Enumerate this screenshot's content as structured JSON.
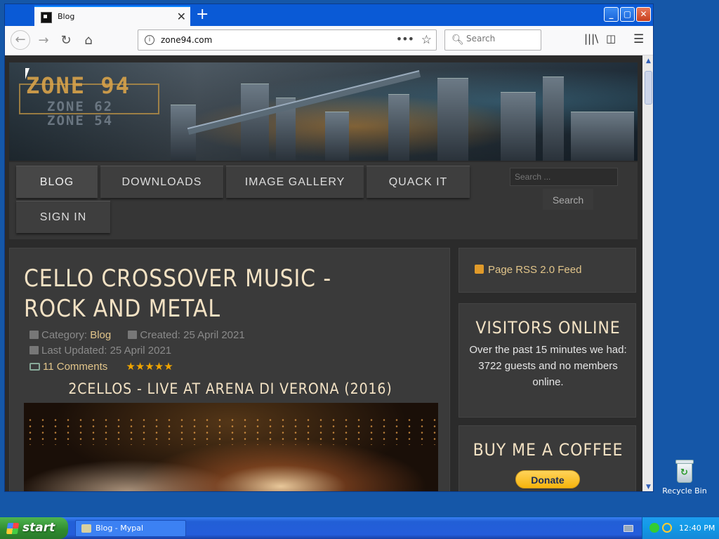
{
  "browser": {
    "tab_title": "Blog",
    "url": "zone94.com",
    "search_placeholder": "Search"
  },
  "site": {
    "logo": "ZONE 94",
    "logo_sub1": "ZONE 62",
    "logo_sub2": "ZONE 54",
    "menu": {
      "blog": "BLOG",
      "downloads": "DOWNLOADS",
      "gallery": "IMAGE GALLERY",
      "quack": "QUACK IT",
      "signin": "SIGN IN"
    },
    "search_placeholder": "Search ...",
    "search_button": "Search"
  },
  "article": {
    "title": "CELLO CROSSOVER MUSIC - ROCK AND METAL",
    "category_label": "Category:",
    "category": "Blog",
    "created": "Created: 25 April 2021",
    "updated": "Last Updated: 25 April 2021",
    "comments": "11 Comments",
    "rating_stars": "★★★★★",
    "video_title": "2CELLOS - LIVE AT ARENA DI VERONA (2016)"
  },
  "sidebar": {
    "rss": "Page RSS 2.0 Feed",
    "visitors_title": "VISITORS ONLINE",
    "visitors_text": "Over the past 15 minutes we had: 3722 guests and no members online.",
    "coffee_title": "BUY ME A COFFEE",
    "donate": "Donate"
  },
  "desktop": {
    "recycle_bin": "Recycle Bin"
  },
  "taskbar": {
    "start": "start",
    "task": "Blog - Mypal",
    "clock": "12:40 PM"
  },
  "colors": {
    "accent_gold": "#f3e2c4",
    "link_gold": "#e2c58a",
    "rating": "#f0a500"
  }
}
